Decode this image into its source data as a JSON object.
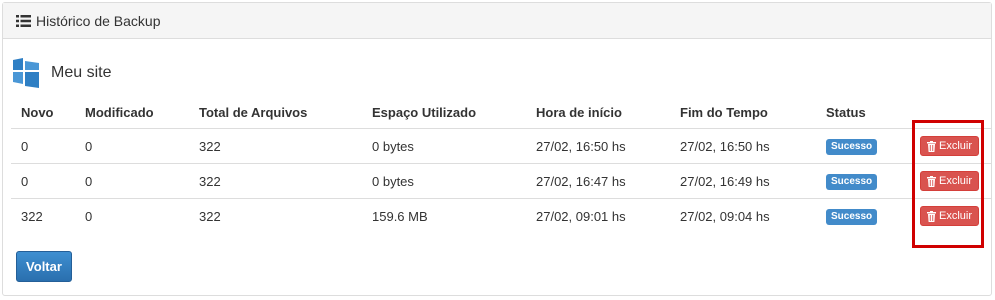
{
  "panel": {
    "title": "Histórico de Backup",
    "title_icon": "list-icon"
  },
  "site": {
    "name": "Meu site",
    "icon": "windows-site-icon"
  },
  "table": {
    "headers": [
      "Novo",
      "Modificado",
      "Total de Arquivos",
      "Espaço Utilizado",
      "Hora de início",
      "Fim do Tempo",
      "Status",
      ""
    ],
    "rows": [
      {
        "novo": "0",
        "modificado": "0",
        "total": "322",
        "espaco": "0 bytes",
        "inicio": "27/02, 16:50 hs",
        "fim": "27/02, 16:50 hs",
        "status": "Sucesso",
        "action": "Excluir"
      },
      {
        "novo": "0",
        "modificado": "0",
        "total": "322",
        "espaco": "0 bytes",
        "inicio": "27/02, 16:47 hs",
        "fim": "27/02, 16:49 hs",
        "status": "Sucesso",
        "action": "Excluir"
      },
      {
        "novo": "322",
        "modificado": "0",
        "total": "322",
        "espaco": "159.6 MB",
        "inicio": "27/02, 09:01 hs",
        "fim": "27/02, 09:04 hs",
        "status": "Sucesso",
        "action": "Excluir"
      }
    ]
  },
  "footer": {
    "back_label": "Voltar"
  },
  "colors": {
    "status_badge": "#428bca",
    "delete_button": "#d9534f",
    "highlight": "#d00000",
    "primary_button": "#337ab7"
  }
}
